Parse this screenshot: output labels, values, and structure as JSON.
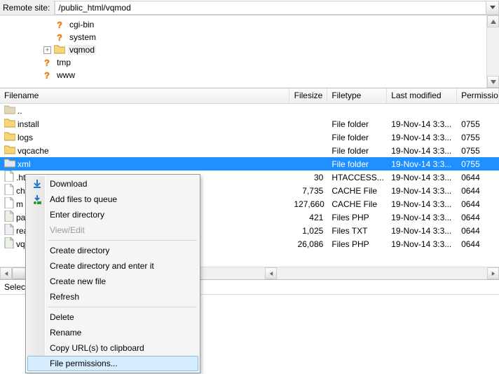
{
  "remote": {
    "label": "Remote site:",
    "path": "/public_html/vqmod"
  },
  "tree": {
    "items": [
      {
        "depth": 2,
        "expand": "none",
        "icon": "question",
        "name": "cgi-bin"
      },
      {
        "depth": 2,
        "expand": "none",
        "icon": "question",
        "name": "system"
      },
      {
        "depth": 2,
        "expand": "plus",
        "icon": "folder",
        "name": "vqmod",
        "selected": true
      },
      {
        "depth": 1,
        "expand": "none",
        "icon": "question",
        "name": "tmp"
      },
      {
        "depth": 1,
        "expand": "none",
        "icon": "question",
        "name": "www"
      }
    ]
  },
  "list": {
    "columns": {
      "name": "Filename",
      "size": "Filesize",
      "type": "Filetype",
      "modified": "Last modified",
      "permissions": "Permissions"
    },
    "rows": [
      {
        "icon": "folder-dim",
        "name": "..",
        "size": "",
        "type": "",
        "modified": "",
        "permissions": ""
      },
      {
        "icon": "folder",
        "name": "install",
        "size": "",
        "type": "File folder",
        "modified": "19-Nov-14 3:3...",
        "permissions": "0755"
      },
      {
        "icon": "folder",
        "name": "logs",
        "size": "",
        "type": "File folder",
        "modified": "19-Nov-14 3:3...",
        "permissions": "0755"
      },
      {
        "icon": "folder",
        "name": "vqcache",
        "size": "",
        "type": "File folder",
        "modified": "19-Nov-14 3:3...",
        "permissions": "0755"
      },
      {
        "icon": "folder",
        "name": "xml",
        "size": "",
        "type": "File folder",
        "modified": "19-Nov-14 3:3...",
        "permissions": "0755",
        "selected": true
      },
      {
        "icon": "file",
        "name": ".ht",
        "size": "30",
        "type": "HTACCESS...",
        "modified": "19-Nov-14 3:3...",
        "permissions": "0644",
        "clipped": true
      },
      {
        "icon": "file",
        "name": "ch",
        "size": "7,735",
        "type": "CACHE File",
        "modified": "19-Nov-14 3:3...",
        "permissions": "0644",
        "clipped": true
      },
      {
        "icon": "file",
        "name": "m",
        "size": "127,660",
        "type": "CACHE File",
        "modified": "19-Nov-14 3:3...",
        "permissions": "0644",
        "clipped": true
      },
      {
        "icon": "file-php",
        "name": "pa",
        "size": "421",
        "type": "Files PHP",
        "modified": "19-Nov-14 3:3...",
        "permissions": "0644",
        "clipped": true
      },
      {
        "icon": "file-txt",
        "name": "rea",
        "size": "1,025",
        "type": "Files TXT",
        "modified": "19-Nov-14 3:3...",
        "permissions": "0644",
        "clipped": true
      },
      {
        "icon": "file-php",
        "name": "vq",
        "size": "26,086",
        "type": "Files PHP",
        "modified": "19-Nov-14 3:3...",
        "permissions": "0644",
        "clipped": true
      }
    ]
  },
  "status": {
    "text": "Select"
  },
  "context_menu": {
    "items": [
      {
        "label": "Download",
        "icon": "download-icon"
      },
      {
        "label": "Add files to queue",
        "icon": "queue-icon"
      },
      {
        "label": "Enter directory"
      },
      {
        "label": "View/Edit",
        "disabled": true
      },
      {
        "sep": true
      },
      {
        "label": "Create directory"
      },
      {
        "label": "Create directory and enter it"
      },
      {
        "label": "Create new file"
      },
      {
        "label": "Refresh"
      },
      {
        "sep": true
      },
      {
        "label": "Delete"
      },
      {
        "label": "Rename"
      },
      {
        "label": "Copy URL(s) to clipboard"
      },
      {
        "label": "File permissions...",
        "hover": true
      }
    ]
  }
}
